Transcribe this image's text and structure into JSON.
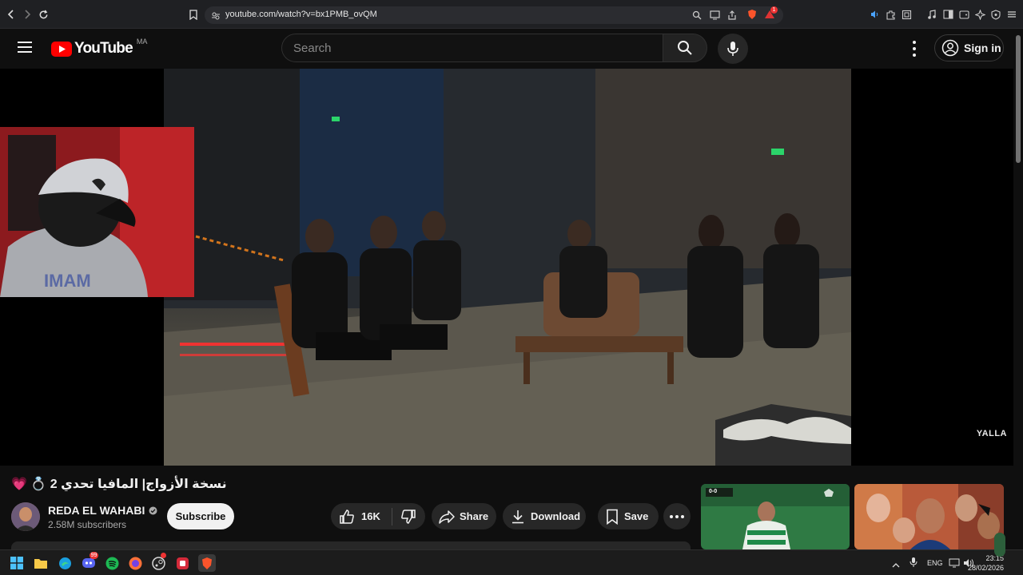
{
  "browser": {
    "url": "youtube.com/watch?v=bx1PMB_ovQM",
    "notification_badge": "1"
  },
  "header": {
    "logo_text": "YouTube",
    "region": "MA",
    "search_placeholder": "Search",
    "sign_in_label": "Sign in"
  },
  "video": {
    "watermark": "YALLA",
    "title": "💗 💍 2 نسخة الأزواج| المافيا تحدي"
  },
  "channel": {
    "name": "REDA EL WAHABI",
    "subscribers": "2.58M subscribers",
    "subscribe_label": "Subscribe"
  },
  "actions": {
    "likes": "16K",
    "share_label": "Share",
    "download_label": "Download",
    "save_label": "Save"
  },
  "recommended": [
    {
      "name": "football-match-thumbnail",
      "score": "0-0"
    },
    {
      "name": "reaction-faces-thumbnail"
    }
  ],
  "taskbar": {
    "discord_badge": "99",
    "language": "ENG",
    "time": "23:15",
    "date": "28/02/2026"
  },
  "colors": {
    "accent_red": "#ff0000",
    "background": "#0f0f0f",
    "pill_bg": "#272727"
  }
}
